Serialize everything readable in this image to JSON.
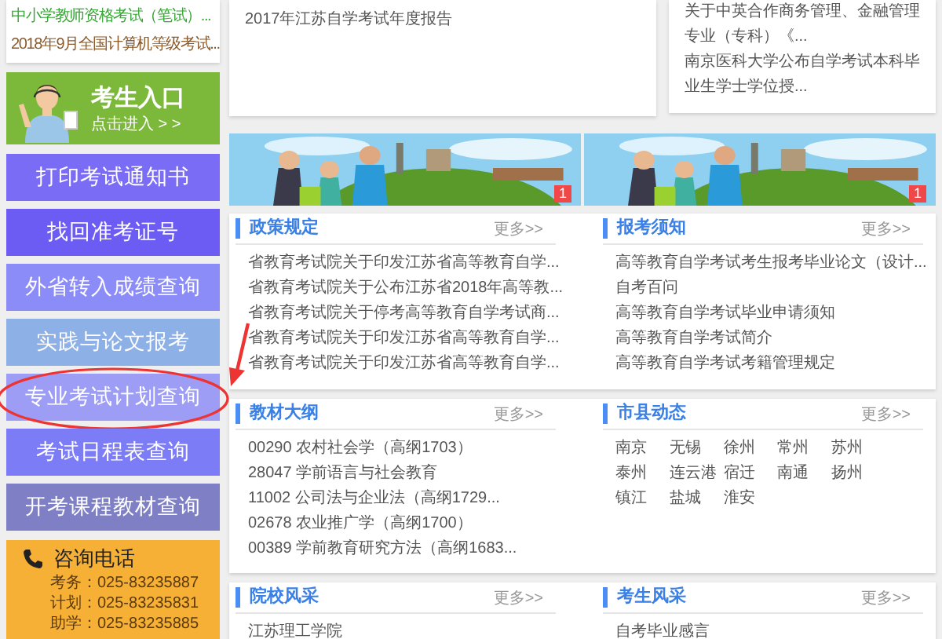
{
  "sidebar": {
    "notices": [
      {
        "text": "中小学教师资格考试（笔试）...",
        "color": "#3aa63a"
      },
      {
        "text": "2018年9月全国计算机等级考试...",
        "color": "#8a5a2a"
      }
    ],
    "entry": {
      "title": "考生入口",
      "subtitle": "点击进入 > >"
    },
    "buttons": [
      {
        "label": "打印考试通知书",
        "color": "#7b6cf5",
        "circled": false
      },
      {
        "label": "找回准考证号",
        "color": "#6d5cf3",
        "circled": false
      },
      {
        "label": "外省转入成绩查询",
        "color": "#8c8cf8",
        "circled": false
      },
      {
        "label": "实践与论文报考",
        "color": "#8db0e6",
        "circled": false
      },
      {
        "label": "专业考试计划查询",
        "color": "#9d9df5",
        "circled": true
      },
      {
        "label": "考试日程表查询",
        "color": "#7c7cf6",
        "circled": false
      },
      {
        "label": "开考课程教材查询",
        "color": "#7f7fc6",
        "circled": false
      }
    ],
    "contact": {
      "title": "咨询电话",
      "lines": [
        "考务：025-83235887",
        "计划：025-83235831",
        "助学：025-83235885"
      ]
    }
  },
  "news_top": {
    "left_items": [
      "2017年江苏自学考试年度报告"
    ],
    "right_items": [
      "关于中英合作商务管理、金融管理专业（专科）《...",
      "南京医科大学公布自学考试本科毕业生学士学位授..."
    ]
  },
  "banners": [
    {
      "badge": "1"
    },
    {
      "badge": "1"
    }
  ],
  "panels": [
    {
      "sections": [
        {
          "title": "政策规定",
          "more": "更多>>",
          "kind": "list",
          "items": [
            "省教育考试院关于印发江苏省高等教育自学...",
            "省教育考试院关于公布江苏省2018年高等教...",
            "省教育考试院关于停考高等教育自学考试商...",
            "省教育考试院关于印发江苏省高等教育自学...",
            "省教育考试院关于印发江苏省高等教育自学..."
          ]
        },
        {
          "title": "报考须知",
          "more": "更多>>",
          "kind": "list",
          "items": [
            "高等教育自学考试考生报考毕业论文（设计...",
            "自考百问",
            "高等教育自学考试毕业申请须知",
            "高等教育自学考试简介",
            "高等教育自学考试考籍管理规定"
          ]
        }
      ]
    },
    {
      "sections": [
        {
          "title": "教材大纲",
          "more": "更多>>",
          "kind": "list",
          "items": [
            "00290 农村社会学（高纲1703）",
            "28047 学前语言与社会教育",
            "11002 公司法与企业法（高纲1729...",
            "02678 农业推广学（高纲1700）",
            "00389 学前教育研究方法（高纲1683..."
          ]
        },
        {
          "title": "市县动态",
          "more": "更多>>",
          "kind": "grid",
          "items": [
            "南京",
            "无锡",
            "徐州",
            "常州",
            "苏州",
            "泰州",
            "连云港",
            "宿迁",
            "南通",
            "扬州",
            "镇江",
            "盐城",
            "淮安"
          ]
        }
      ]
    },
    {
      "sections": [
        {
          "title": "院校风采",
          "more": "更多>>",
          "kind": "list",
          "items": [
            "江苏理工学院"
          ]
        },
        {
          "title": "考生风采",
          "more": "更多>>",
          "kind": "list",
          "items": [
            "自考毕业感言"
          ]
        }
      ]
    }
  ]
}
